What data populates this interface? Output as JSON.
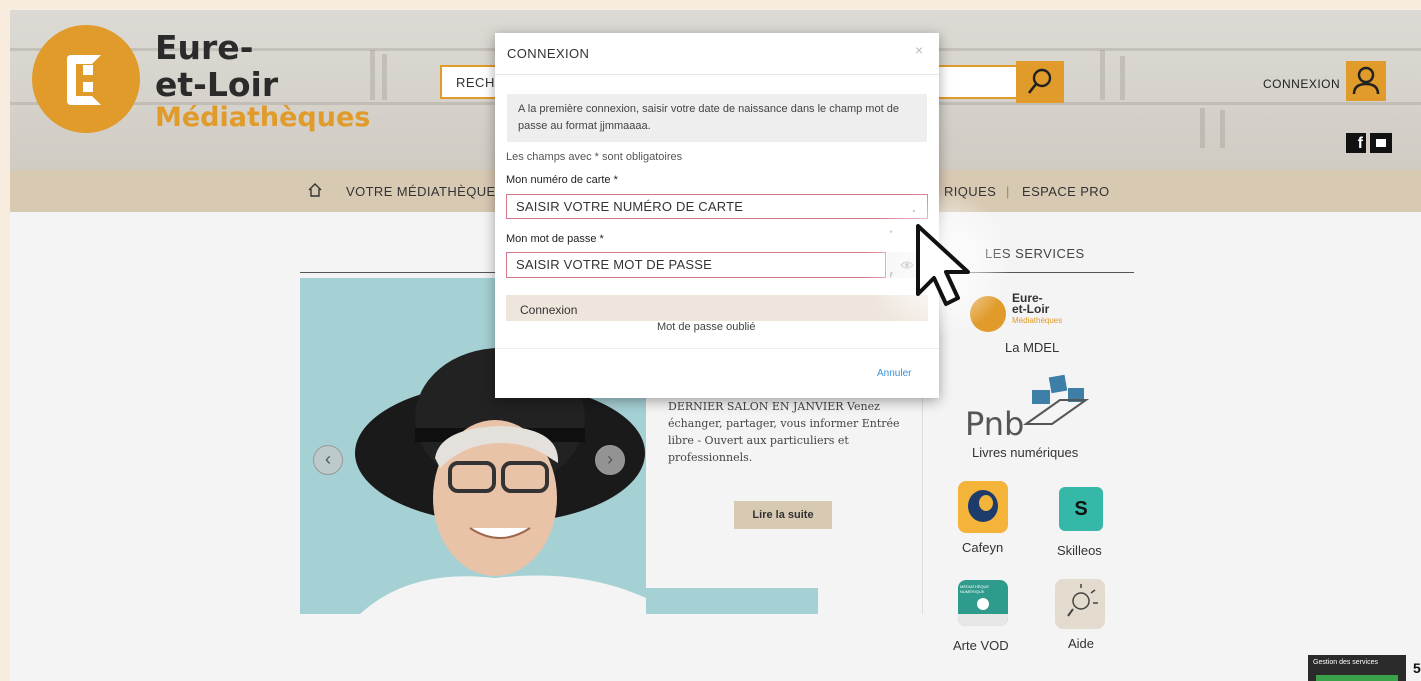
{
  "header": {
    "logo": {
      "line1": "Eure-",
      "line2": "et-Loir",
      "line3": "Médiathèques"
    },
    "search_placeholder": "RECH",
    "connexion_label": "CONNEXION",
    "social": {
      "facebook": "f"
    }
  },
  "nav": {
    "items": [
      "VOTRE MÉDIATHÈQUE",
      "RIQUES",
      "|",
      "ESPACE PRO"
    ]
  },
  "sidebar": {
    "title": "LES SERVICES",
    "services": [
      {
        "label": "La MDEL",
        "logo_text_1": "Eure-",
        "logo_text_2": "et-Loir",
        "logo_text_3": "Médiathèques"
      },
      {
        "label": "Livres numériques",
        "logo_text": "Pnb"
      },
      {
        "label": "Cafeyn"
      },
      {
        "label": "Skilleos",
        "logo_text": "S"
      },
      {
        "label": "Arte VOD",
        "logo_text": "MÉDIATHÈQUE NUMÉRIQUE"
      },
      {
        "label": "Aide"
      }
    ]
  },
  "carousel": {
    "text": "DERNIER SALON EN JANVIER Venez échanger, partager, vous informer Entrée libre - Ouvert aux particuliers et professionnels.",
    "read_more": "Lire la suite",
    "prev": "‹",
    "next": "›"
  },
  "cookie_bar": {
    "label": "Gestion des services"
  },
  "corner_glyph": "5",
  "modal": {
    "title": "CONNEXION",
    "close": "×",
    "info": "A la première connexion, saisir votre date de naissance dans le champ mot de passe au format jjmmaaaa.",
    "required_note": "Les champs avec * sont obligatoires",
    "card_label": "Mon numéro de carte *",
    "card_placeholder": "SAISIR VOTRE NUMÉRO DE CARTE",
    "password_label": "Mon mot de passe *",
    "password_placeholder": "SAISIR VOTRE MOT DE PASSE",
    "login_button": "Connexion",
    "forgot_password": "Mot de passe oublié",
    "cancel": "Annuler"
  },
  "colors": {
    "brand_orange": "#e09b2a",
    "nav_beige": "#d8c9b3",
    "error_border": "#d7788a",
    "link_blue": "#3a8fd6"
  }
}
